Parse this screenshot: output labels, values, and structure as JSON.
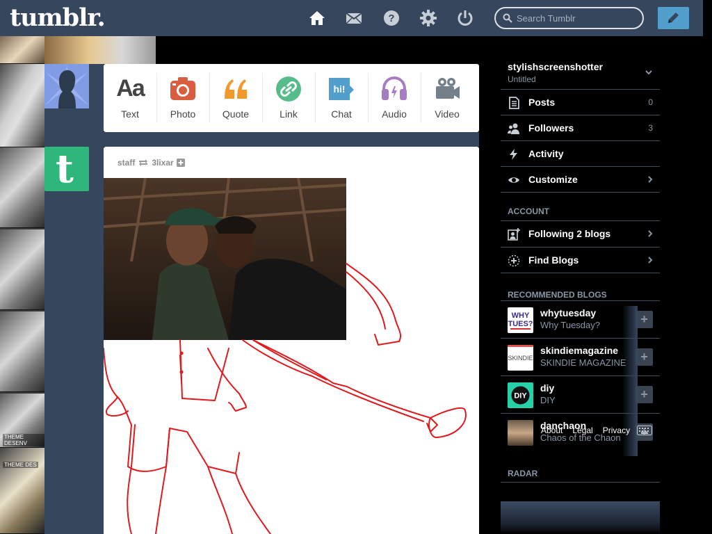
{
  "header": {
    "logo": "tumblr.",
    "search_placeholder": "Search Tumblr"
  },
  "nav_icons": [
    "home-icon",
    "mail-icon",
    "help-icon",
    "gear-icon",
    "power-icon",
    "pencil-icon"
  ],
  "strip_labels": [
    "THEME DESENV",
    "THEME DES"
  ],
  "post_types": [
    {
      "label": "Text",
      "icon": "text-icon",
      "color": "#444444"
    },
    {
      "label": "Photo",
      "icon": "camera-icon",
      "color": "#d95e40"
    },
    {
      "label": "Quote",
      "icon": "quote-icon",
      "color": "#f2992e"
    },
    {
      "label": "Link",
      "icon": "link-icon",
      "color": "#56bc8a"
    },
    {
      "label": "Chat",
      "icon": "chat-icon",
      "color": "#529ecc"
    },
    {
      "label": "Audio",
      "icon": "headphones-icon",
      "color": "#a77dc2"
    },
    {
      "label": "Video",
      "icon": "video-camera-icon",
      "color": "#748089"
    }
  ],
  "post": {
    "author": "staff",
    "reblogged_from": "3lixar"
  },
  "sidebar": {
    "blog_name": "stylishscreenshotter",
    "blog_title": "Untitled",
    "items": [
      {
        "label": "Posts",
        "count": "0",
        "icon": "document-icon"
      },
      {
        "label": "Followers",
        "count": "3",
        "icon": "people-icon"
      },
      {
        "label": "Activity",
        "icon": "lightning-icon"
      },
      {
        "label": "Customize",
        "icon": "eye-icon"
      }
    ],
    "account_heading": "ACCOUNT",
    "account_items": [
      {
        "label": "Following 2 blogs",
        "icon": "add-person-icon"
      },
      {
        "label": "Find Blogs",
        "icon": "find-icon"
      }
    ],
    "recommended_heading": "RECOMMENDED BLOGS",
    "recommended": [
      {
        "name": "whytuesday",
        "title": "Why Tuesday?"
      },
      {
        "name": "skindiemagazine",
        "title": "SKINDIE MAGAZINE"
      },
      {
        "name": "diy",
        "title": "DIY"
      },
      {
        "name": "danchaon",
        "title": "Chaos of the Chaon"
      }
    ],
    "footer_links": [
      "About",
      "Legal",
      "Privacy"
    ],
    "radar_heading": "RADAR"
  }
}
